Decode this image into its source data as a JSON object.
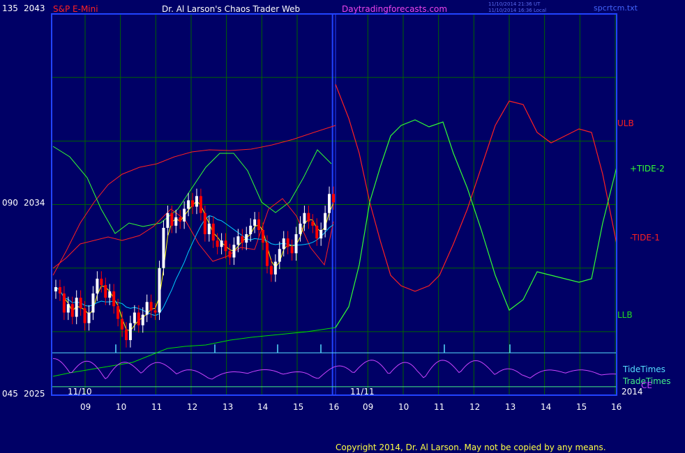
{
  "header": {
    "instrument": "S&P E-Mini",
    "title": "Dr. Al Larson's Chaos Trader Web",
    "site": "Daytradingforecasts.com",
    "timestamp_1": "11/10/2014 21:36 UT",
    "timestamp_2": "11/10/2014 16:36 Local",
    "file": "spcrtcm.txt"
  },
  "footer": {
    "copyright": "Copyright 2014, Dr. Al Larson. May not be copied by any means."
  },
  "colors": {
    "background": "#000066",
    "frame": "#2244ff",
    "grid": "#006400",
    "price_up": "#ffffff",
    "price_down": "#ff0000",
    "ma_fast": "#ffff00",
    "ma_slow": "#00ccff",
    "band_upper": "#ff2020",
    "band_lower": "#00dd00",
    "tide_plus": "#33ff33",
    "tide_minus": "#ff2020",
    "tide_times": "#cc44ff",
    "tidetimes_line": "#55ddff",
    "tradetimes_line": "#44ee88"
  },
  "chart_data": {
    "type": "candlestick",
    "title": "S&P E-Mini",
    "y_axis": {
      "labels": [
        {
          "left": "135",
          "right": "2043",
          "value": 2043
        },
        {
          "left": "090",
          "right": "2034",
          "value": 2034
        },
        {
          "left": "045",
          "right": "2025",
          "value": 2025
        }
      ],
      "ylim": [
        2025,
        2043
      ]
    },
    "x_axis": {
      "hour_ticks": [
        "09",
        "10",
        "11",
        "12",
        "13",
        "14",
        "15",
        "16",
        "09",
        "10",
        "11",
        "12",
        "13",
        "14",
        "15",
        "16"
      ],
      "date_labels": [
        "11/10",
        "11/11"
      ],
      "year_label": "2014"
    },
    "series_labels": {
      "ulb": "ULB",
      "tide_plus": "+TIDE-2",
      "tide_minus": "-TIDE-1",
      "llb": "LLB",
      "tidetimes": "TideTimes",
      "tradetimes": "TradeTimes",
      "overlay": "CE"
    },
    "price_closes": [
      2030.1,
      2029.8,
      2028.9,
      2029.3,
      2028.7,
      2029.6,
      2029.1,
      2028.4,
      2028.9,
      2029.8,
      2030.5,
      2030.2,
      2029.6,
      2029.9,
      2029.2,
      2028.6,
      2028.1,
      2027.6,
      2028.4,
      2028.9,
      2028.3,
      2028.8,
      2029.4,
      2029.0,
      2028.9,
      2031.0,
      2032.9,
      2033.6,
      2033.0,
      2033.4,
      2033.2,
      2033.8,
      2034.2,
      2033.9,
      2034.4,
      2033.6,
      2032.6,
      2033.1,
      2032.3,
      2032.0,
      2032.3,
      2031.8,
      2031.5,
      2032.1,
      2032.5,
      2032.2,
      2032.6,
      2033.0,
      2033.3,
      2032.8,
      2032.2,
      2031.1,
      2030.7,
      2031.3,
      2031.9,
      2032.4,
      2032.0,
      2031.7,
      2032.6,
      2033.1,
      2033.6,
      2033.2,
      2033.0,
      2032.4,
      2032.8,
      2033.6,
      2034.5,
      2034.1
    ],
    "tidetimes_line_y": 2027.0,
    "tradetimes_line_y": 2025.4
  }
}
